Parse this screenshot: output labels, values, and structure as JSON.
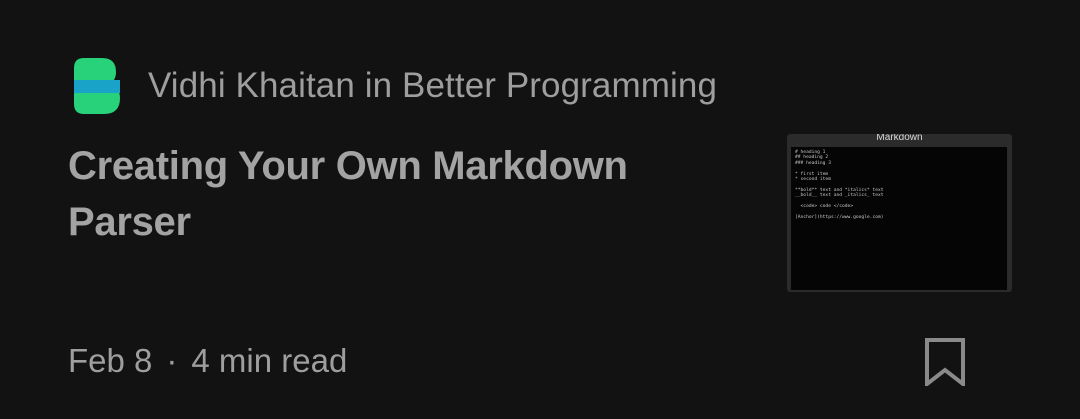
{
  "publisher": {
    "logo_icon": "better-programming-logo-icon",
    "logo_colors": [
      "#27d27a",
      "#1aa3c9"
    ]
  },
  "byline": {
    "author": "Vidhi Khaitan",
    "connector": "in",
    "publication": "Better Programming"
  },
  "article": {
    "title": "Creating Your Own Markdown Parser",
    "date": "Feb 8",
    "separator": "·",
    "read_time": "4 min read"
  },
  "thumbnail": {
    "caption": "Markdown",
    "lines": [
      "# heading 1",
      "## heading 2",
      "### heading 3",
      "",
      "* first item",
      "* second item",
      "",
      "**bold** text and *italics* text",
      "__bold__ text and _italics_ text",
      "",
      "  <code> code </code>",
      "",
      "[Anchor](https://www.google.com)"
    ]
  },
  "actions": {
    "bookmark_icon": "bookmark-icon"
  }
}
